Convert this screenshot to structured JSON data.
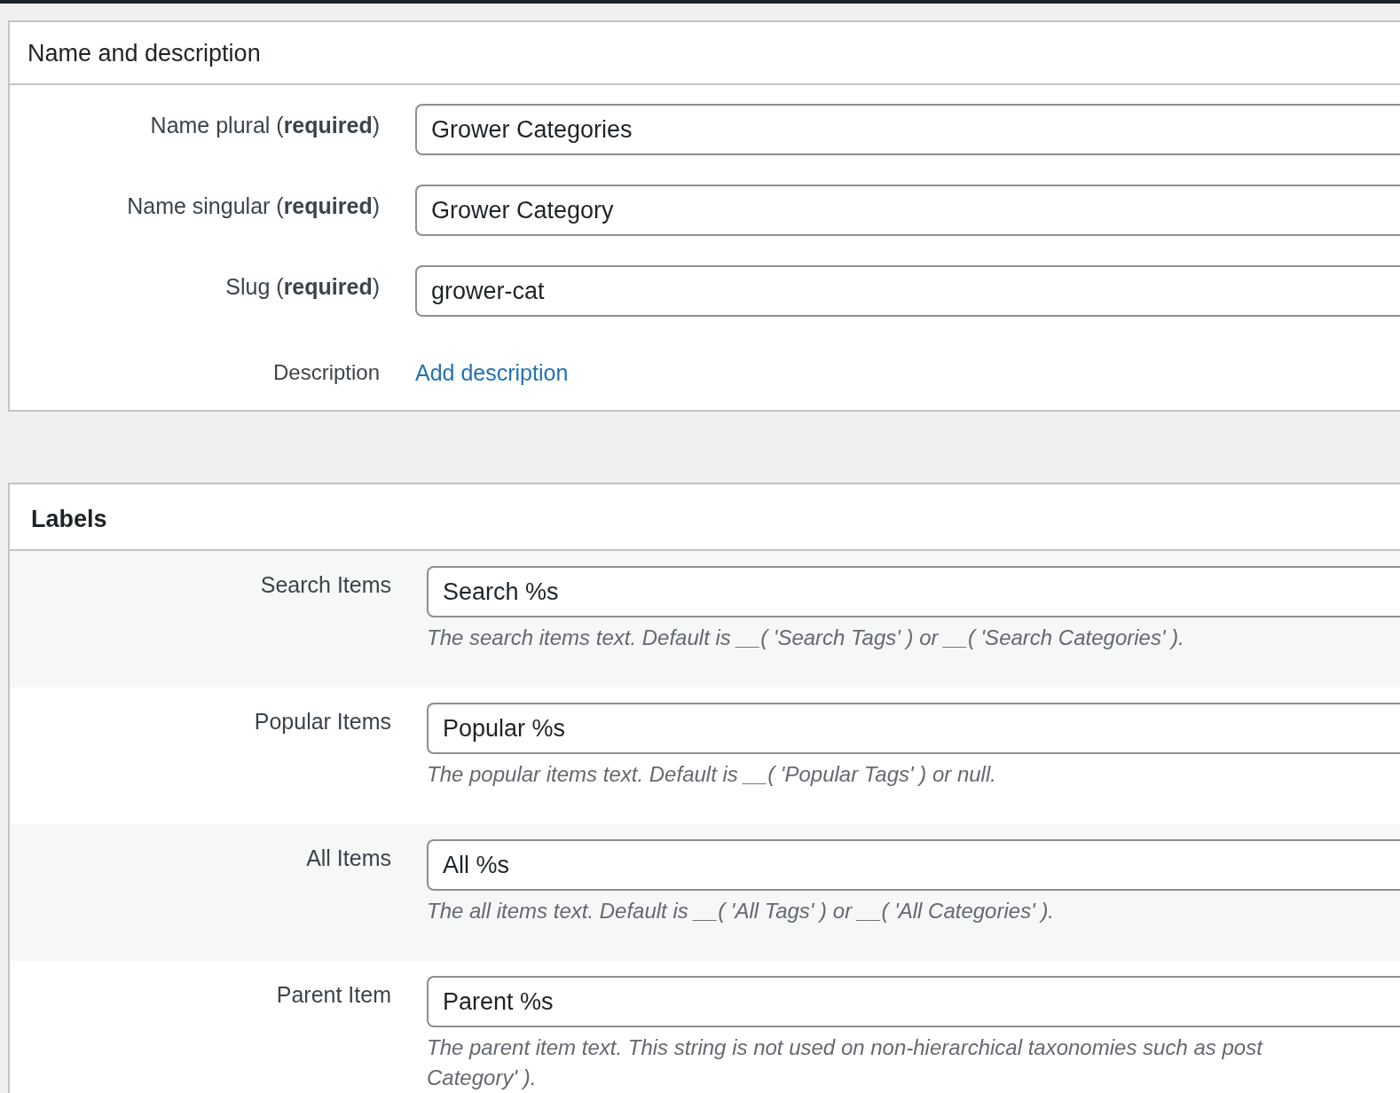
{
  "name_panel": {
    "title": "Name and description",
    "fields": [
      {
        "label": "Name plural (**required**)",
        "value": "Grower Categories"
      },
      {
        "label": "Name singular (**required**)",
        "value": "Grower Category"
      },
      {
        "label": "Slug (**required**)",
        "value": "grower-cat"
      }
    ],
    "description": {
      "label": "Description",
      "link": "Add description"
    }
  },
  "labels_panel": {
    "title": "Labels",
    "rows": [
      {
        "label": "Search Items",
        "value": "Search %s",
        "help": [
          "The search items text. Default is __( 'Search Tags' ) or __( 'Search Categories' )."
        ]
      },
      {
        "label": "Popular Items",
        "value": "Popular %s",
        "help": [
          "The popular items text. Default is __( 'Popular Tags' ) or null."
        ]
      },
      {
        "label": "All Items",
        "value": "All %s",
        "help": [
          "The all items text. Default is __( 'All Tags' ) or __( 'All Categories' )."
        ]
      },
      {
        "label": "Parent Item",
        "value": "Parent %s",
        "help": [
          "The parent item text. This string is not used on non-hierarchical taxonomies such as post",
          "Category' )."
        ]
      }
    ]
  }
}
